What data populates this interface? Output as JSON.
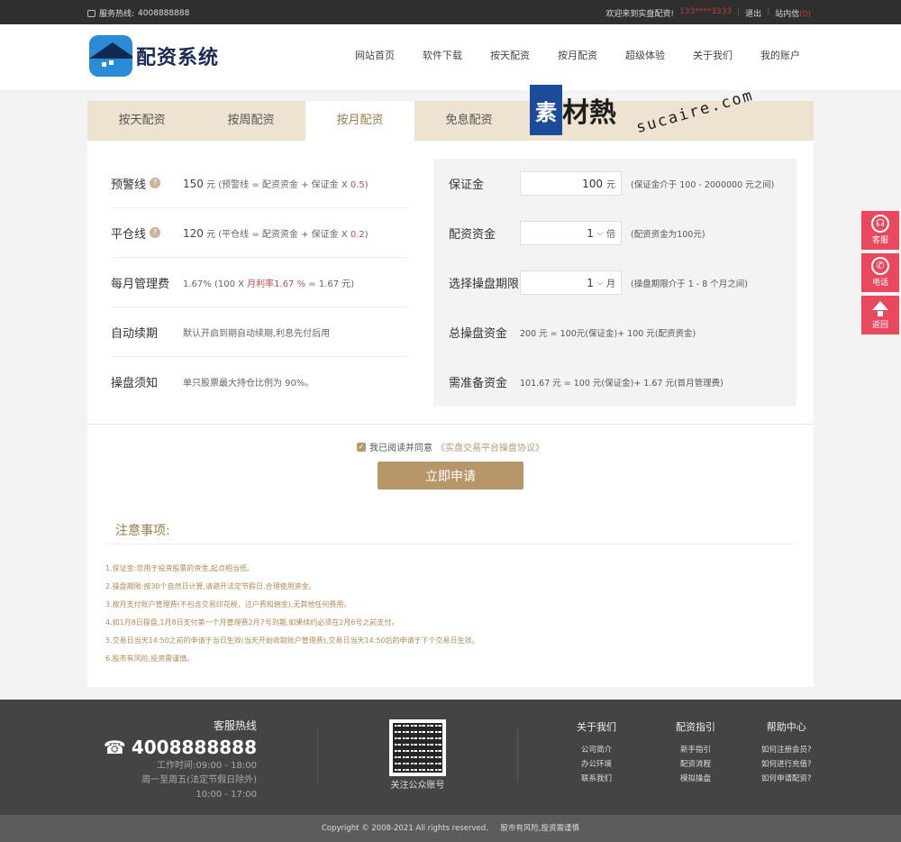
{
  "topbar": {
    "hotline_label": "服务热线:",
    "hotline": "4008888888",
    "welcome": "欢迎来到实盘配资!",
    "user": "133****3333",
    "logout": "退出",
    "inbox": "站内信",
    "inbox_count": "(0)"
  },
  "header": {
    "logo_text": "配资系统",
    "nav": [
      "网站首页",
      "软件下载",
      "按天配资",
      "按月配资",
      "超级体验",
      "关于我们",
      "我的账户"
    ]
  },
  "watermark": {
    "box": "素",
    "chars": "材熱",
    "url": "sucaire.com"
  },
  "tabs": [
    {
      "label": "按天配资",
      "active": false
    },
    {
      "label": "按周配资",
      "active": false
    },
    {
      "label": "按月配资",
      "active": true
    },
    {
      "label": "免息配资",
      "active": false
    }
  ],
  "left_rows": [
    {
      "label": "预警线",
      "amount": "150",
      "unit": "元",
      "formula_pre": "(预警线 = 配资资金 + 保证金 X",
      "rate": "0.5",
      "formula_post": ")"
    },
    {
      "label": "平仓线",
      "amount": "120",
      "unit": "元",
      "formula_pre": "(平仓线 = 配资资金 + 保证金 X",
      "rate": "0.2",
      "formula_post": ")"
    },
    {
      "label": "每月管理费",
      "text_pre": "1.67%  (100 X ",
      "rate": "月利率1.67 %",
      "text_post": " = 1.67 元)"
    },
    {
      "label": "自动续期",
      "text": "默认开启到期自动续期,利息先付后用"
    },
    {
      "label": "操盘须知",
      "text": "单只股票最大持仓比例为 90%。"
    }
  ],
  "right_rows": {
    "margin": {
      "label": "保证金",
      "value": "100",
      "unit": "元",
      "hint": "(保证金介于 100 - 2000000 元之间)"
    },
    "fund": {
      "label": "配资资金",
      "value": "1",
      "unit": "倍",
      "hint": "(配资资金为100元)"
    },
    "period": {
      "label": "选择操盘期限",
      "value": "1",
      "unit": "月",
      "hint": "(操盘期限介于 1 - 8 个月之间)"
    },
    "total": {
      "label": "总操盘资金",
      "text": "200 元 = 100元(保证金)+ 100 元(配资资金)"
    },
    "prepare": {
      "label": "需准备资金",
      "text": "101.67 元 = 100 元(保证金)+ 1.67 元(首月管理费)"
    }
  },
  "agree": {
    "text": "我已阅读并同意",
    "link": "《实盘交易平台操盘协议》"
  },
  "apply_button": "立即申请",
  "notes": {
    "title": "注意事项:",
    "items": [
      "1.保证金:您用于投资股票的资金,起点相当低。",
      "2.操盘期限:按30个自然日计算,请避开法定节假日,合理使用资金。",
      "3.按月支付账户管理费(不包含交易印花税、过户费和佣金),无其他任何费用。",
      "4.如1月8日操盘,1月8日支付第一个月管理费2月7号到期,如果续约必须在2月6号之前支付。",
      "5.交易日当天14:50之前的申请于当日生效(当天开始收取账户管理费),交易日当天14:50后的申请于下个交易日生效。",
      "6.股市有风险,投资需谨慎。"
    ]
  },
  "side_buttons": {
    "service": "客服",
    "phone": "电话",
    "back": "返回"
  },
  "footer": {
    "hotline_title": "客服热线",
    "hotline": "4008888888",
    "hours_1": "工作时间:09:00 - 18:00",
    "hours_2": "周一至周五(法定节假日除外)",
    "hours_3": "10:00 - 17:00",
    "qr_label": "关注公众账号",
    "cols": [
      {
        "title": "关于我们",
        "items": [
          "公司简介",
          "办公环境",
          "联系我们"
        ]
      },
      {
        "title": "配资指引",
        "items": [
          "新手指引",
          "配资流程",
          "模拟操盘"
        ]
      },
      {
        "title": "帮助中心",
        "items": [
          "如何注册会员?",
          "如何进行充值?",
          "如何申请配资?"
        ]
      }
    ],
    "copyright": "Copyright © 2008-2021 All rights reserved.",
    "risk": "股市有风险,投资需谨慎"
  }
}
